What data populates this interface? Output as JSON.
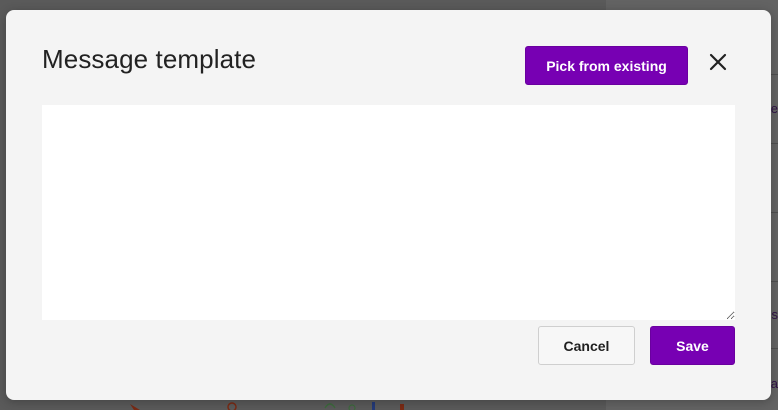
{
  "modal": {
    "title": "Message template",
    "pick_button_label": "Pick from existing",
    "close_icon": "close-icon",
    "textarea_value": "",
    "textarea_placeholder": "",
    "cancel_label": "Cancel",
    "save_label": "Save"
  },
  "background": {
    "fragments": [
      "e",
      "s",
      "a"
    ]
  },
  "colors": {
    "accent": "#7700b3",
    "modal_background": "#f4f4f4",
    "overlay": "#5a5a5a"
  }
}
